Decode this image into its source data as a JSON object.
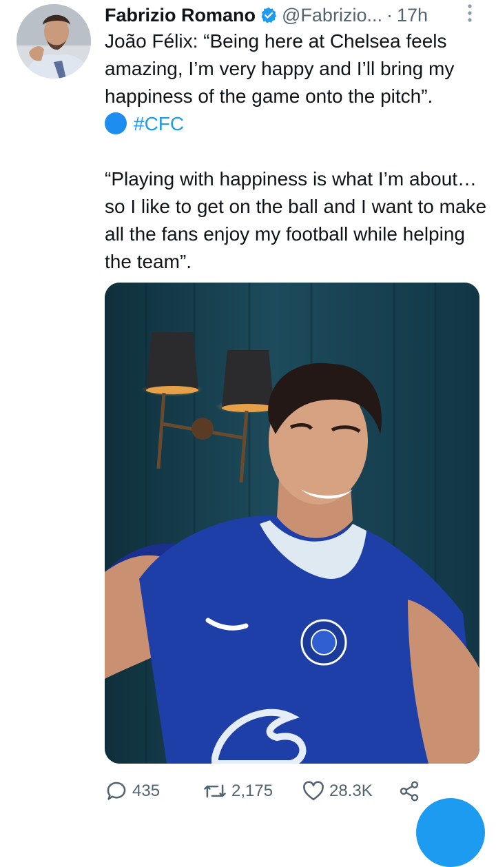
{
  "tweet": {
    "author": {
      "name": "Fabrizio Romano",
      "handle": "@Fabrizio...",
      "separator": "·",
      "time": "17h",
      "verified": true
    },
    "text": {
      "para1": "João Félix: “Being here at Chelsea feels amazing, I’m very happy and I’ll bring my happiness of the game onto the pitch”.",
      "hashtag": "#CFC",
      "para2": "“Playing with happiness is what I’m about… so I like to get on the ball and I want to make all the fans enjoy my football while helping the team”."
    },
    "icons": {
      "verified": "verified-badge-icon",
      "more": "more-vertical-icon",
      "emoji": "blue-circle-emoji-icon",
      "reply": "reply-icon",
      "retweet": "retweet-icon",
      "like": "heart-icon",
      "share": "share-icon"
    },
    "stats": {
      "replies": "435",
      "retweets": "2,175",
      "likes": "28.3K"
    }
  },
  "colors": {
    "link": "#1d9bf0",
    "secondary_text": "#536471",
    "jersey_blue": "#1f3fa8"
  }
}
